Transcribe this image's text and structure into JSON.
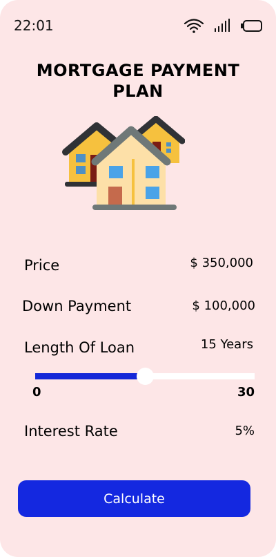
{
  "status_bar": {
    "time": "22:01"
  },
  "title": "MORTGAGE PAYMENT PLAN",
  "fields": {
    "price": {
      "label": "Price",
      "value": "$ 350,000"
    },
    "down_payment": {
      "label": "Down Payment",
      "value": "$ 100,000"
    },
    "loan_length": {
      "label": "Length Of Loan",
      "value": "15 Years"
    },
    "interest_rate": {
      "label": "Interest Rate",
      "value": "5%"
    }
  },
  "slider": {
    "min_label": "0",
    "max_label": "30",
    "min": 0,
    "max": 30,
    "value": 15
  },
  "button": {
    "label": "Calculate"
  },
  "colors": {
    "background": "#fde6e7",
    "accent": "#1428e0",
    "slider_fill": "#1428d8"
  },
  "icons": [
    "wifi-icon",
    "signal-icon",
    "battery-icon",
    "houses-illustration"
  ]
}
